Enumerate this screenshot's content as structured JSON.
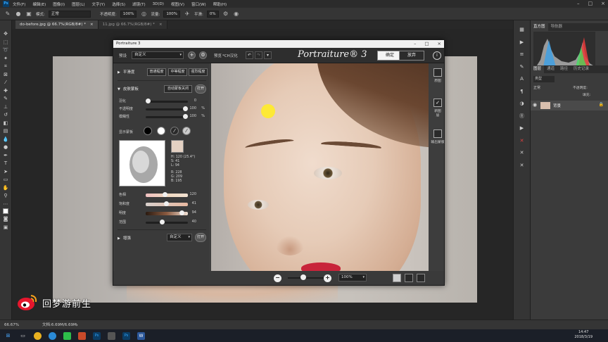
{
  "menubar": {
    "items": [
      "文件(F)",
      "编辑(E)",
      "图像(I)",
      "图层(L)",
      "文字(Y)",
      "选择(S)",
      "滤镜(T)",
      "3D(D)",
      "视图(V)",
      "窗口(W)",
      "帮助(H)"
    ],
    "logo": "Ps"
  },
  "options": {
    "mode_label": "模式:",
    "mode_value": "正常",
    "opacity_label": "不透明度:",
    "opacity_value": "100%",
    "flow_label": "流量:",
    "flow_value": "100%",
    "smooth_label": "平滑:",
    "smooth_value": "0%"
  },
  "tabs": [
    {
      "label": "do-before.jpg @ 66.7%(RGB/8#) *",
      "active": true
    },
    {
      "label": "11.jpg @ 66.7%(RGB/8#) *",
      "active": false
    }
  ],
  "plugin": {
    "title": "Portraiture 3",
    "preset_label": "预设",
    "preset_value": "自定义",
    "preview_label": "预览",
    "localized_label": "*CH汉化",
    "brand": "Portraiture® 3",
    "ok_label": "确定",
    "cancel_label": "放弃",
    "info_label": "i",
    "smoothing": {
      "head": "平滑度",
      "btn_normal": "普通程度",
      "btn_medium": "中等程度",
      "btn_strong": "强烈程度"
    },
    "skin_mask": {
      "head": "皮肤蒙板",
      "auto_label": "自动蒙板关闭",
      "open_label": "打开",
      "feather_label": "羽化",
      "feather_value": "0",
      "opacity_label": "不透明度",
      "opacity_value": "100",
      "opacity_unit": "%",
      "fuzz_label": "模糊性",
      "fuzz_value": "100",
      "fuzz_unit": "%",
      "show_mask_label": "显示蒙板",
      "hsl_h": "H: 120 (25.4°)",
      "hsl_s": "S: 41",
      "hsl_l": "L: 94",
      "rgb_r": "R: 228",
      "rgb_g": "G: 209",
      "rgb_b": "B: 195",
      "hue_label": "色相",
      "hue_value": "120",
      "sat_label": "饱和度",
      "sat_value": "41",
      "bright_label": "明度",
      "bright_value": "94",
      "range_label": "范围",
      "range_value": "40"
    },
    "enhance": {
      "head": "增强",
      "preset_value": "自定义",
      "open_label": "打开"
    },
    "right_toggles": {
      "original_label": "原图",
      "new_layer_label": "新图层",
      "output_mask_label": "输出蒙版"
    },
    "zoom_value": "100%"
  },
  "right_panel": {
    "histogram_tabs": [
      "直方图",
      "导航器"
    ],
    "layer_tabs": [
      "图层",
      "通道",
      "路径",
      "历史记录"
    ],
    "kind_label": "类型",
    "mode_label": "正常",
    "opacity_label": "不透明度:",
    "fill_label": "填充:",
    "layer_name": "背景"
  },
  "status": {
    "zoom": "66.67%",
    "doc": "文档:6.69M/6.69M"
  },
  "taskbar": {
    "time": "14:47",
    "date": "2018/3/19"
  },
  "watermark": {
    "text": "回梦游前生"
  }
}
